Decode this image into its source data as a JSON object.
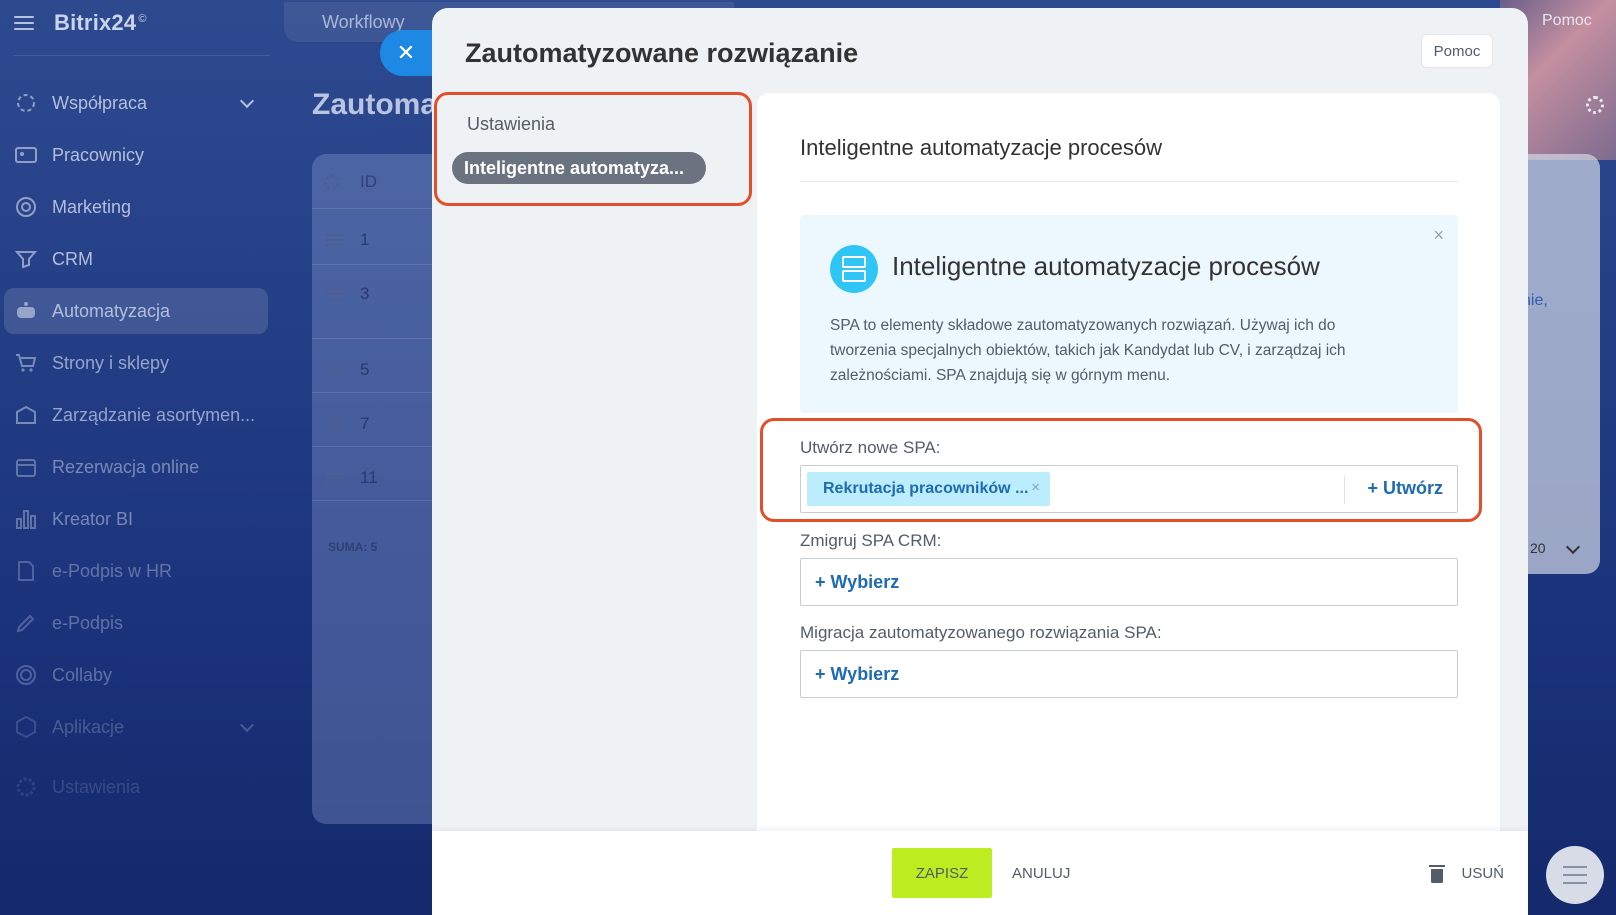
{
  "app": {
    "logo": "Bitrix24",
    "logo_mark": "©"
  },
  "sidebar": {
    "items": [
      {
        "label": "Współpraca",
        "icon": "collab-icon"
      },
      {
        "label": "Pracownicy",
        "icon": "employees-icon"
      },
      {
        "label": "Marketing",
        "icon": "marketing-icon"
      },
      {
        "label": "CRM",
        "icon": "crm-icon"
      },
      {
        "label": "Automatyzacja",
        "icon": "automation-icon"
      },
      {
        "label": "Strony i sklepy",
        "icon": "cart-icon"
      },
      {
        "label": "Zarządzanie asortymen...",
        "icon": "inventory-icon"
      },
      {
        "label": "Rezerwacja online",
        "icon": "calendar-icon"
      },
      {
        "label": "Kreator BI",
        "icon": "chart-icon"
      },
      {
        "label": "e-Podpis w HR",
        "icon": "document-icon"
      },
      {
        "label": "e-Podpis",
        "icon": "signature-icon"
      },
      {
        "label": "Collaby",
        "icon": "collaby-icon"
      },
      {
        "label": "Aplikacje",
        "icon": "apps-icon"
      },
      {
        "label": "Ustawienia",
        "icon": "gear-icon"
      }
    ]
  },
  "background": {
    "top_tab": "Workflowy",
    "page_title": "Zautoma",
    "table": {
      "header_id": "ID",
      "rows": [
        "1",
        "3",
        "5",
        "7",
        "11"
      ],
      "total": "SUMA: 5"
    },
    "help": "Pomoc",
    "right_snippet": "nie,",
    "page_size": "20"
  },
  "slider": {
    "title": "Zautomatyzowane rozwiązanie",
    "help_label": "Pomoc",
    "nav": {
      "settings": "Ustawienia",
      "active": "Inteligentne automatyza..."
    },
    "section_title": "Inteligentne automatyzacje procesów",
    "info": {
      "title": "Inteligentne automatyzacje procesów",
      "text": "SPA to elementy składowe zautomatyzowanych rozwiązań. Używaj ich do tworzenia specjalnych obiektów, takich jak Kandydat lub CV, i zarządzaj ich zależnościami. SPA znajdują się w górnym menu.",
      "close": "×"
    },
    "fields": {
      "create_label": "Utwórz nowe SPA:",
      "create_tag": "Rekrutacja pracowników ...",
      "create_tag_remove": "×",
      "create_button": "+ Utwórz",
      "migrate_label": "Zmigruj SPA CRM:",
      "migrate_button": "+ Wybierz",
      "migration_label": "Migracja zautomatyzowanego rozwiązania SPA:",
      "migration_button": "+ Wybierz"
    },
    "footer": {
      "save": "ZAPISZ",
      "cancel": "ANULUJ",
      "delete": "USUŃ"
    }
  },
  "colors": {
    "accent": "#2fc6f6",
    "save": "#bbed21",
    "highlight": "#e24f2a",
    "link": "#1f6ab5"
  }
}
